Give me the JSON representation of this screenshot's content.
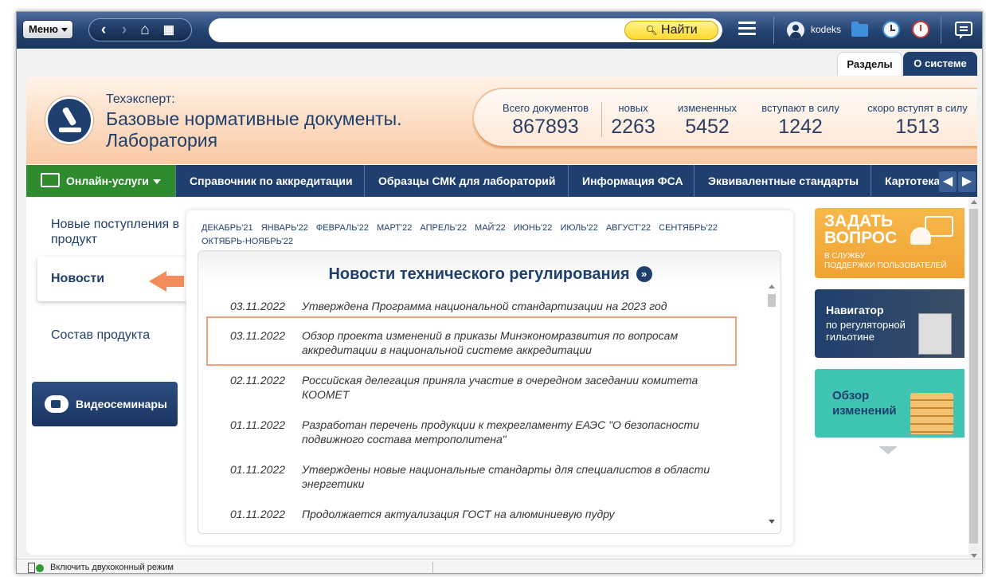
{
  "toolbar": {
    "menu_label": "Меню",
    "search_value": "",
    "find_label": "Найти",
    "user_name": "kodeks"
  },
  "tabs": [
    {
      "label": "Разделы",
      "active": true
    },
    {
      "label": "О системе",
      "active": false
    }
  ],
  "product": {
    "subtitle": "Техэксперт:",
    "title": "Базовые нормативные документы. Лаборатория"
  },
  "stats": [
    {
      "label": "Всего документов",
      "value": "867893"
    },
    {
      "label": "новых",
      "value": "2263"
    },
    {
      "label": "измененных",
      "value": "5452"
    },
    {
      "label": "вступают в силу",
      "value": "1242"
    },
    {
      "label": "скоро вступят в силу",
      "value": "1513"
    }
  ],
  "services": [
    {
      "label": "Онлайн-услуги"
    },
    {
      "label": "Справочник по аккредитации"
    },
    {
      "label": "Образцы СМК для лабораторий"
    },
    {
      "label": "Информация ФСА"
    },
    {
      "label": "Эквивалентные стандарты"
    },
    {
      "label": "Картотека"
    }
  ],
  "sidebar": {
    "items": [
      {
        "label": "Новые поступления в продукт"
      },
      {
        "label": "Новости"
      },
      {
        "label": "Состав продукта"
      }
    ],
    "webinar_label": "Видеосеминары"
  },
  "months": [
    "ДЕКАБРЬ'21",
    "ЯНВАРЬ'22",
    "ФЕВРАЛЬ'22",
    "МАРТ'22",
    "АПРЕЛЬ'22",
    "МАЙ'22",
    "ИЮНЬ'22",
    "ИЮЛЬ'22",
    "АВГУСТ'22",
    "СЕНТЯБРЬ'22",
    "ОКТЯБРЬ-НОЯБРЬ'22"
  ],
  "news": {
    "title": "Новости технического регулирования",
    "items": [
      {
        "date": "03.11.2022",
        "text": "Утверждена Программа национальной стандартизации на 2023 год"
      },
      {
        "date": "03.11.2022",
        "text": "Обзор проекта изменений в приказы Минэкономразвития по вопросам аккредитации в национальной системе аккредитации"
      },
      {
        "date": "02.11.2022",
        "text": "Российская делегация приняла участие в очередном заседании комитета КООМЕТ"
      },
      {
        "date": "01.11.2022",
        "text": "Разработан перечень продукции к техрегламенту ЕАЭС \"О безопасности подвижного состава метрополитена\""
      },
      {
        "date": "01.11.2022",
        "text": "Утверждены новые национальные стандарты для специалистов в области энергетики"
      },
      {
        "date": "01.11.2022",
        "text": "Продолжается актуализация ГОСТ на алюминиевую пудру"
      }
    ]
  },
  "promos": {
    "ask": {
      "line1": "ЗАДАТЬ",
      "line2": "ВОПРОС",
      "sub1": "В СЛУЖБУ",
      "sub2": "ПОДДЕРЖКИ ПОЛЬЗОВАТЕЛЕЙ"
    },
    "navigator": {
      "title": "Навигатор",
      "sub1": "по регуляторной",
      "sub2": "гильотине"
    },
    "review": {
      "line1": "Обзор",
      "line2": "изменений"
    }
  },
  "statusbar": {
    "dual_mode_label": "Включить двухоконный режим"
  }
}
